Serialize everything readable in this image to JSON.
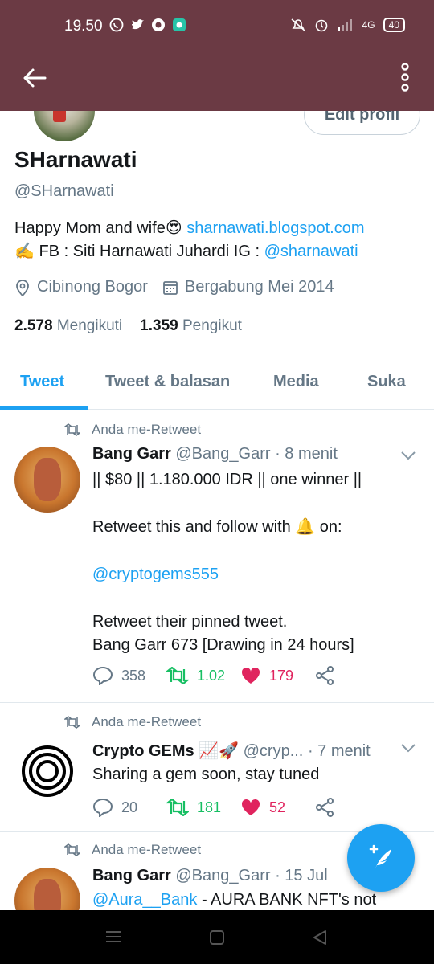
{
  "status_bar": {
    "time": "19.50",
    "network": "4G",
    "battery": "40"
  },
  "profile": {
    "edit_label": "Edit profil",
    "name": "SHarnawati",
    "handle": "@SHarnawati",
    "bio_text": "Happy Mom and wife😍",
    "bio_link": "sharnawati.blogspot.com",
    "bio_line2": "✍️ FB : Siti Harnawati Juhardi IG : ",
    "bio_mention": "@sharnawati",
    "location": "Cibinong Bogor",
    "joined": "Bergabung Mei 2014",
    "following_count": "2.578",
    "following_label": "Mengikuti",
    "followers_count": "1.359",
    "followers_label": "Pengikut"
  },
  "tabs": [
    {
      "label": "Tweet",
      "active": true
    },
    {
      "label": "Tweet & balasan",
      "active": false
    },
    {
      "label": "Media",
      "active": false
    },
    {
      "label": "Suka",
      "active": false
    }
  ],
  "tweets": [
    {
      "retweet_label": "Anda me-Retweet",
      "author": "Bang Garr",
      "handle": "@Bang_Garr",
      "time": "· 8 menit",
      "line1": "|| $80 || 1.180.000 IDR || one winner ||",
      "line2": "Retweet this and follow with 🔔 on:",
      "mention": "@cryptogems555",
      "line3": "Retweet their pinned tweet.",
      "line4": "Bang Garr 673 [Drawing in 24 hours]",
      "replies": "358",
      "retweets": "1.02",
      "likes": "179"
    },
    {
      "retweet_label": "Anda me-Retweet",
      "author": "Crypto GEMs 📈🚀",
      "handle": "@cryp...",
      "time": "· 7 menit",
      "line1": "Sharing a gem soon, stay tuned",
      "replies": "20",
      "retweets": "181",
      "likes": "52"
    },
    {
      "retweet_label": "Anda me-Retweet",
      "author": "Bang Garr",
      "handle": "@Bang_Garr",
      "time": "· 15 Jul",
      "mention": "@Aura__Bank",
      "line1": " - AURA BANK NFT's not"
    }
  ],
  "colors": {
    "app_bar": "#6b3a44",
    "accent": "#1da1f2",
    "retweet": "#17bf63",
    "like": "#e0245e"
  }
}
